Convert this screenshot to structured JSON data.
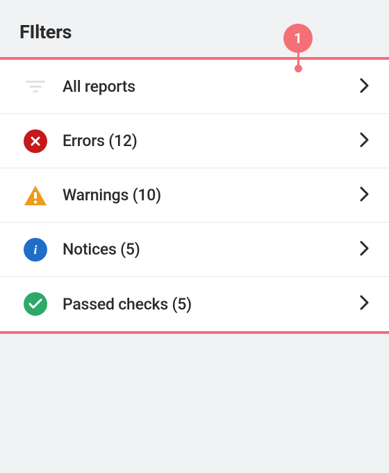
{
  "header": {
    "title": "FIlters"
  },
  "annotation": {
    "number": "1"
  },
  "filters": [
    {
      "key": "all",
      "label": "All reports",
      "icon": "filter-lines-icon"
    },
    {
      "key": "errors",
      "label": "Errors (12)",
      "icon": "error-circle-icon"
    },
    {
      "key": "warnings",
      "label": "Warnings (10)",
      "icon": "warning-triangle-icon"
    },
    {
      "key": "notices",
      "label": "Notices (5)",
      "icon": "info-circle-icon"
    },
    {
      "key": "passed",
      "label": "Passed checks (5)",
      "icon": "check-circle-icon"
    }
  ],
  "colors": {
    "accent": "#f56f77",
    "error": "#c41a1a",
    "warning": "#ee9b1c",
    "info": "#1f6dc9",
    "success": "#2fa96a"
  }
}
